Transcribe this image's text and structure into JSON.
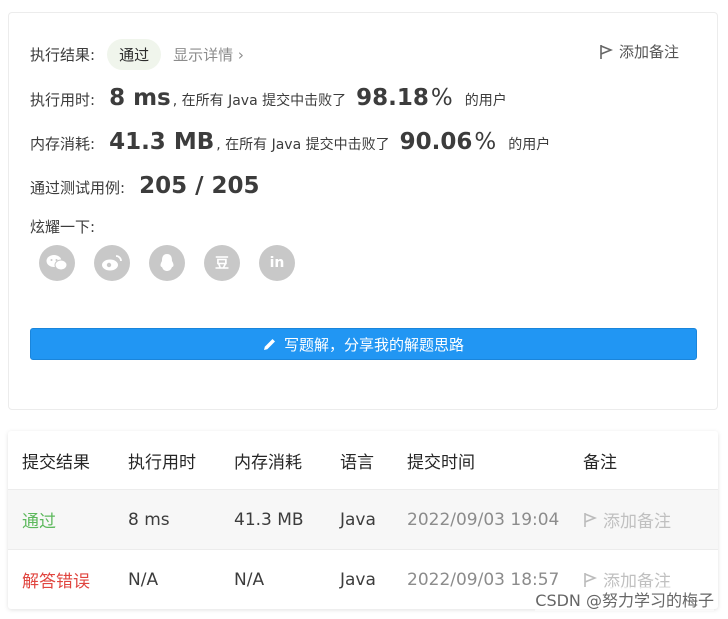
{
  "result": {
    "status_label": "执行结果:",
    "status_value": "通过",
    "detail_link": "显示详情",
    "add_note": "添加备注",
    "runtime_label": "执行用时:",
    "runtime_value": "8 ms",
    "runtime_text": ", 在所有 Java 提交中击败了",
    "runtime_percent": "98.18",
    "percent_sign": "%",
    "users_text": "的用户",
    "memory_label": "内存消耗:",
    "memory_value": "41.3 MB",
    "memory_text": ", 在所有 Java 提交中击败了",
    "memory_percent": "90.06",
    "tests_label": "通过测试用例:",
    "tests_value": "205 / 205",
    "share_label": "炫耀一下:",
    "share_icons": [
      "wechat-icon",
      "weibo-icon",
      "qq-icon",
      "douban-icon",
      "linkedin-icon"
    ],
    "douban_glyph": "豆",
    "linkedin_glyph": "in",
    "write_solution": "写题解，分享我的解题思路"
  },
  "submissions": {
    "headers": [
      "提交结果",
      "执行用时",
      "内存消耗",
      "语言",
      "提交时间",
      "备注"
    ],
    "rows": [
      {
        "result": "通过",
        "time": "8 ms",
        "memory": "41.3 MB",
        "lang": "Java",
        "submitted": "2022/09/03 19:04",
        "note": "添加备注"
      },
      {
        "result": "解答错误",
        "time": "N/A",
        "memory": "N/A",
        "lang": "Java",
        "submitted": "2022/09/03 18:57",
        "note": "添加备注"
      }
    ]
  },
  "colors": {
    "accent": "#2196f3",
    "pass": "#5cb85c",
    "fail": "#e0453f"
  },
  "watermark": "CSDN @努力学习的梅子"
}
